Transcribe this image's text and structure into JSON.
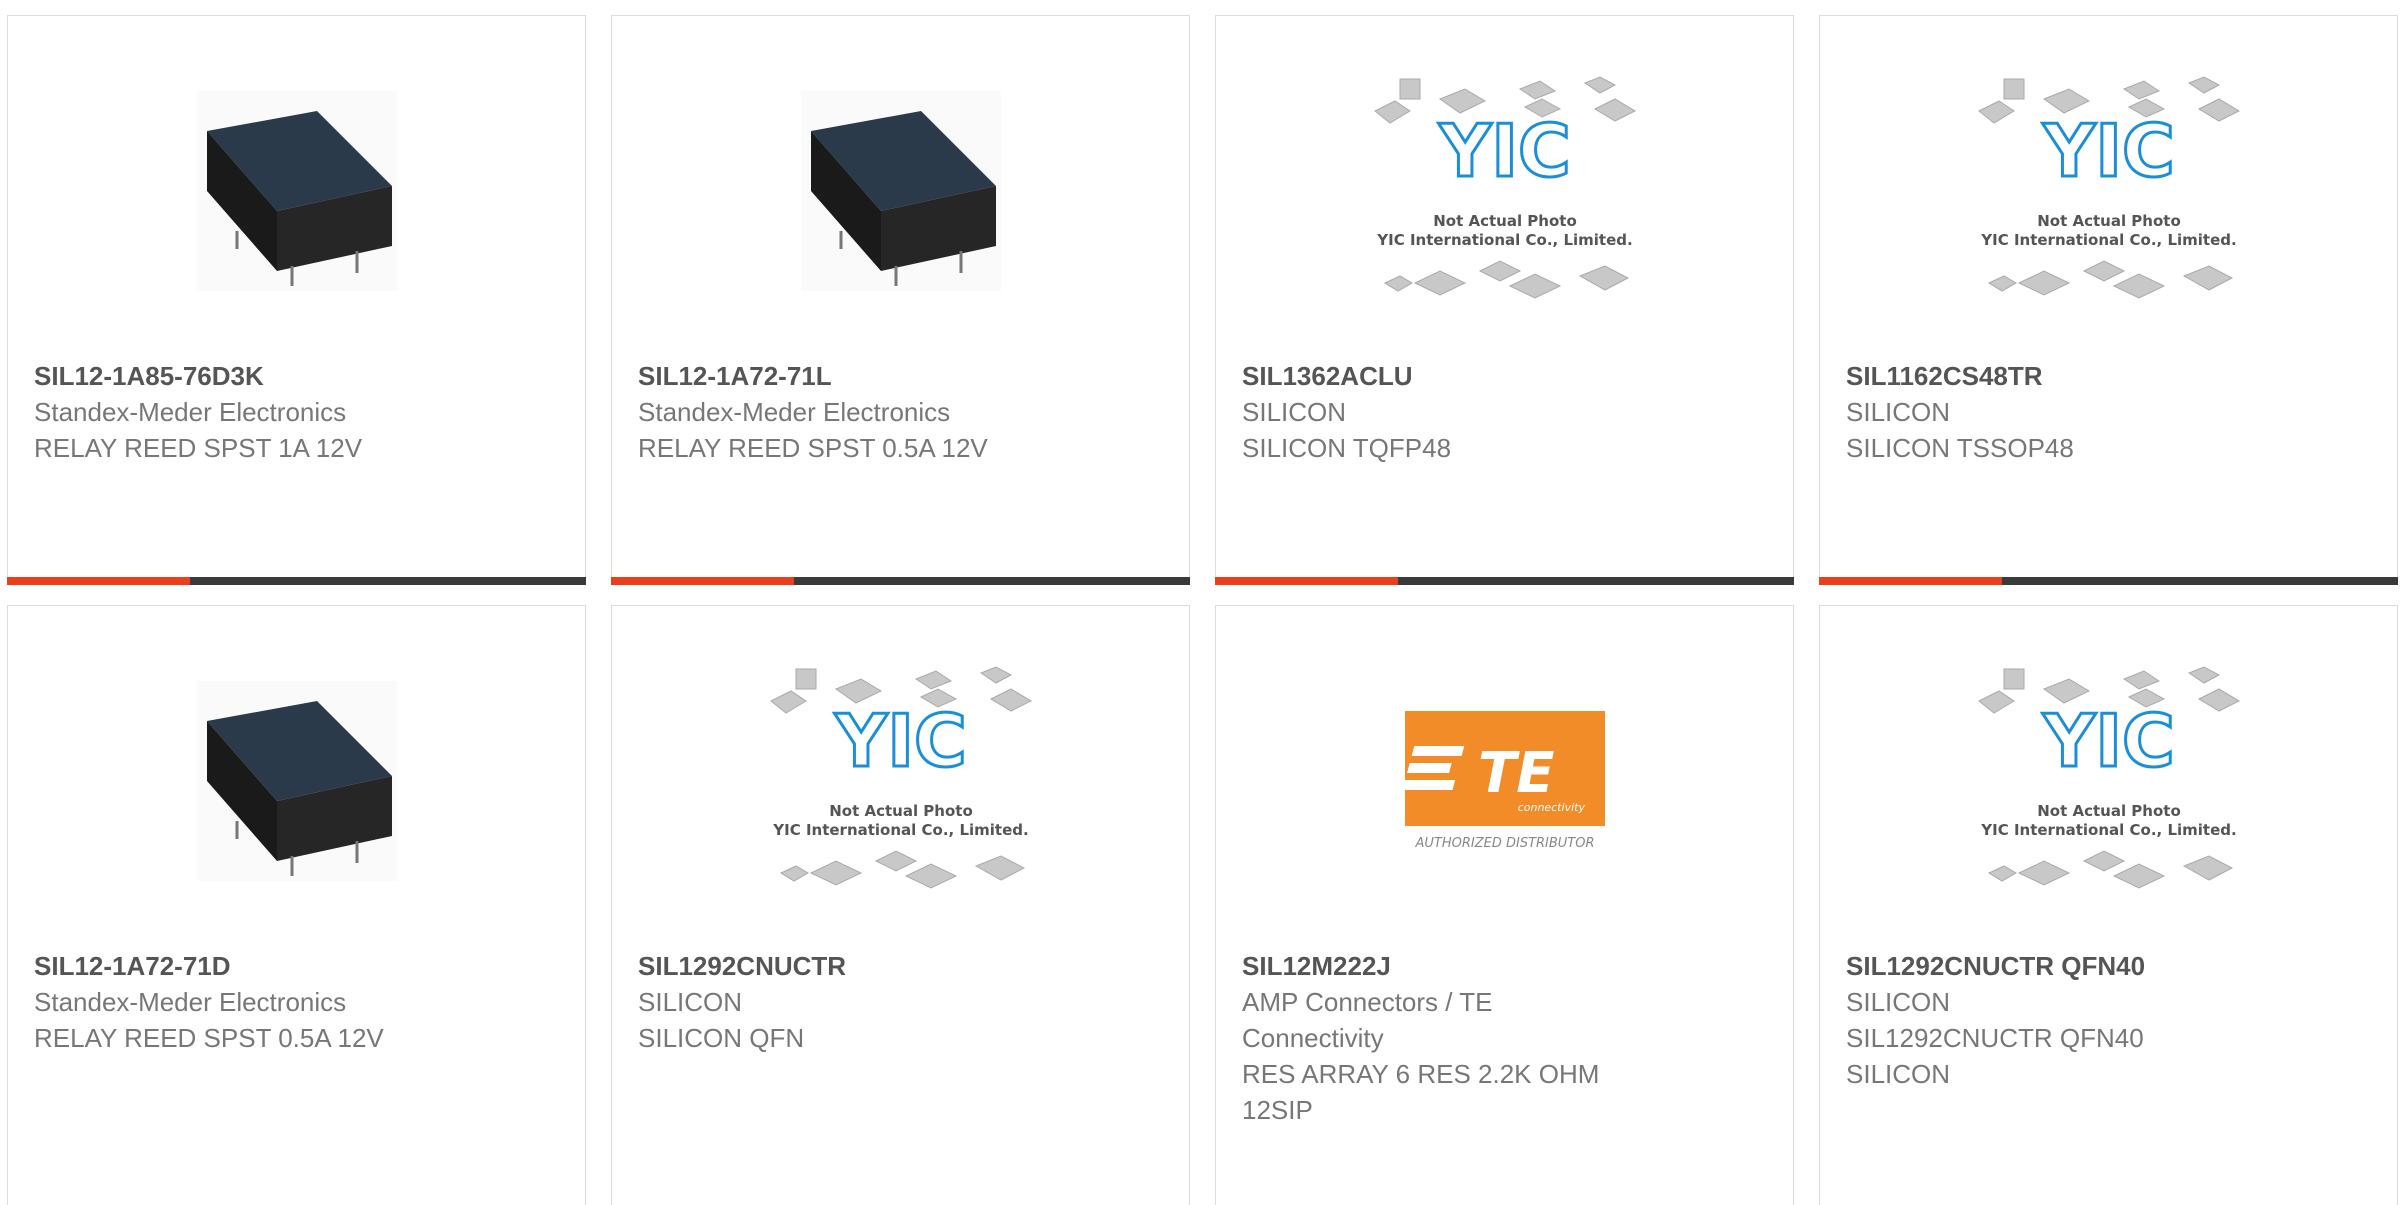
{
  "colors": {
    "accent": "#e8401c",
    "bar_dark": "#3a3a3a",
    "te_orange": "#f28c28"
  },
  "cards": [
    {
      "part": "SIL12-1A85-76D3K",
      "lines": [
        "Standex-Meder Electronics",
        "RELAY REED SPST 1A 12V"
      ],
      "image": "relay-image"
    },
    {
      "part": "SIL12-1A72-71L",
      "lines": [
        "Standex-Meder Electronics",
        "RELAY REED SPST 0.5A 12V"
      ],
      "image": "relay-image"
    },
    {
      "part": "SIL1362ACLU",
      "lines": [
        "SILICON",
        "SILICON TQFP48"
      ],
      "image": "yic-placeholder-image",
      "image_text": [
        "Not Actual Photo",
        "YIC International Co., Limited."
      ]
    },
    {
      "part": "SIL1162CS48TR",
      "lines": [
        "SILICON",
        "SILICON TSSOP48"
      ],
      "image": "yic-placeholder-image",
      "image_text": [
        "Not Actual Photo",
        "YIC International Co., Limited."
      ]
    },
    {
      "part": "SIL12-1A72-71D",
      "lines": [
        "Standex-Meder Electronics",
        "RELAY REED SPST 0.5A 12V"
      ],
      "image": "relay-image"
    },
    {
      "part": "SIL1292CNUCTR",
      "lines": [
        "SILICON",
        "SILICON QFN"
      ],
      "image": "yic-placeholder-image",
      "image_text": [
        "Not Actual Photo",
        "YIC International Co., Limited."
      ]
    },
    {
      "part": "SIL12M222J",
      "lines": [
        "AMP Connectors / TE",
        "Connectivity",
        "RES ARRAY 6 RES 2.2K OHM",
        "12SIP"
      ],
      "image": "te-connectivity-logo",
      "image_text": [
        "connectivity",
        "AUTHORIZED DISTRIBUTOR"
      ]
    },
    {
      "part": "SIL1292CNUCTR QFN40",
      "lines": [
        "SILICON",
        "SIL1292CNUCTR QFN40",
        "SILICON"
      ],
      "image": "yic-placeholder-image",
      "image_text": [
        "Not Actual Photo",
        "YIC International Co., Limited."
      ]
    }
  ]
}
